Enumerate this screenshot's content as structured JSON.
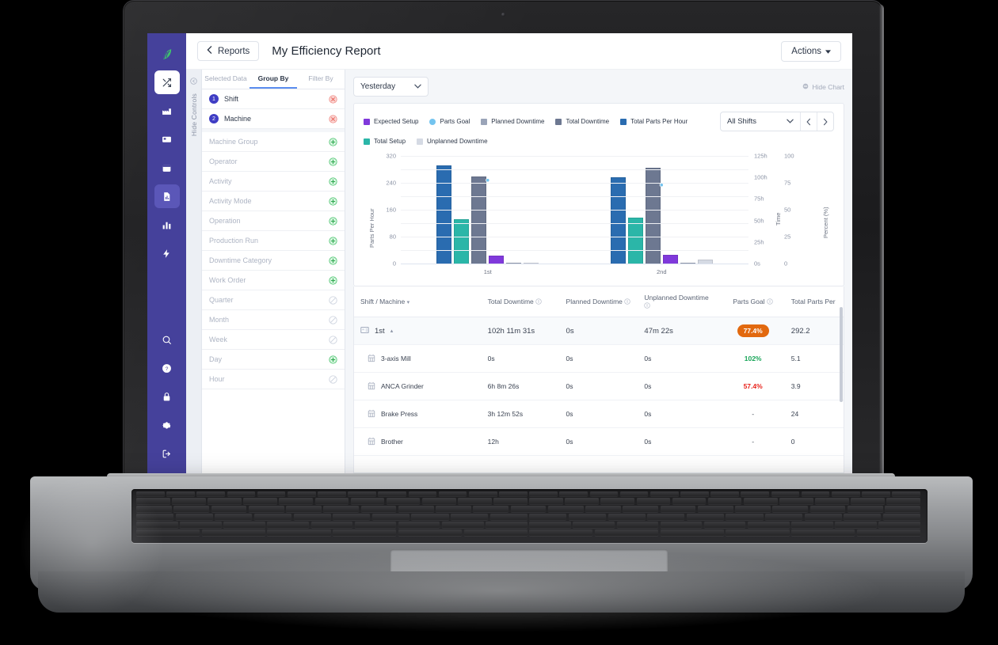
{
  "brand": {
    "logo_icon": "leaf-logo-icon",
    "nav_bg": "#45419b"
  },
  "left_nav": {
    "items": [
      {
        "icon": "shuffle-icon",
        "name": "shuffle",
        "state": "white"
      },
      {
        "icon": "factory-icon",
        "name": "factory",
        "state": "normal"
      },
      {
        "icon": "machine-monitor-icon",
        "name": "machine-monitor",
        "state": "normal"
      },
      {
        "icon": "calendar-icon",
        "name": "calendar",
        "state": "normal"
      },
      {
        "icon": "report-icon",
        "name": "report",
        "state": "active"
      },
      {
        "icon": "bar-chart-icon",
        "name": "analytics",
        "state": "normal"
      },
      {
        "icon": "bolt-icon",
        "name": "energy",
        "state": "normal"
      }
    ],
    "bottom_items": [
      {
        "icon": "search-icon",
        "name": "search"
      },
      {
        "icon": "help-icon",
        "name": "help"
      },
      {
        "icon": "lock-icon",
        "name": "lock"
      },
      {
        "icon": "gear-icon",
        "name": "settings"
      },
      {
        "icon": "logout-icon",
        "name": "logout"
      }
    ]
  },
  "topbar": {
    "back_label": "Reports",
    "back_icon": "chevron-left-icon",
    "title": "My Efficiency Report",
    "actions_label": "Actions",
    "actions_caret_icon": "caret-down-icon"
  },
  "controls": {
    "rail_label": "Hide Controls",
    "rail_icon": "collapse-icon",
    "tabs": [
      {
        "label": "Selected Data",
        "active": false
      },
      {
        "label": "Group By",
        "active": true
      },
      {
        "label": "Filter By",
        "active": false
      }
    ],
    "selected": [
      {
        "index": "1",
        "label": "Shift",
        "action_icon": "remove-icon"
      },
      {
        "index": "2",
        "label": "Machine",
        "action_icon": "remove-icon"
      }
    ],
    "available": [
      {
        "label": "Machine Group",
        "action_icon": "add-icon",
        "enabled": true
      },
      {
        "label": "Operator",
        "action_icon": "add-icon",
        "enabled": true
      },
      {
        "label": "Activity",
        "action_icon": "add-icon",
        "enabled": true
      },
      {
        "label": "Activity Mode",
        "action_icon": "add-icon",
        "enabled": true
      },
      {
        "label": "Operation",
        "action_icon": "add-icon",
        "enabled": true
      },
      {
        "label": "Production Run",
        "action_icon": "add-icon",
        "enabled": true
      },
      {
        "label": "Downtime Category",
        "action_icon": "add-icon",
        "enabled": true
      },
      {
        "label": "Work Order",
        "action_icon": "add-icon",
        "enabled": true
      },
      {
        "label": "Quarter",
        "action_icon": "disabled-icon",
        "enabled": false
      },
      {
        "label": "Month",
        "action_icon": "disabled-icon",
        "enabled": false
      },
      {
        "label": "Week",
        "action_icon": "disabled-icon",
        "enabled": false
      },
      {
        "label": "Day",
        "action_icon": "add-icon",
        "enabled": true
      },
      {
        "label": "Hour",
        "action_icon": "disabled-icon",
        "enabled": false
      }
    ]
  },
  "main": {
    "date_range": "Yesterday",
    "date_caret_icon": "chevron-down-icon",
    "hide_chart_label": "Hide Chart",
    "hide_chart_icon": "hide-icon",
    "shift_selector": {
      "value": "All Shifts",
      "caret_icon": "chevron-down-icon",
      "prev_icon": "chevron-left-icon",
      "next_icon": "chevron-right-icon"
    }
  },
  "chart_data": {
    "type": "bar",
    "title": "",
    "categories": [
      "1st",
      "2nd"
    ],
    "xlabel": "",
    "ylabel": "Parts Per Hour",
    "ylim": [
      0,
      320
    ],
    "yticks": [
      0,
      80,
      160,
      240,
      320
    ],
    "y2label": "Time",
    "y2ticks": [
      "0s",
      "25h",
      "50h",
      "75h",
      "100h",
      "125h"
    ],
    "y3label": "Percent (%)",
    "y3ticks": [
      0,
      25,
      50,
      75,
      100
    ],
    "grid": true,
    "legend_position": "top",
    "series": [
      {
        "name": "Total Parts Per Hour",
        "color": "#2a6cb0",
        "type": "bar",
        "values": [
          292.2,
          256.0
        ]
      },
      {
        "name": "Total Setup",
        "color": "#2bb6a8",
        "type": "bar",
        "values": [
          131.0,
          137.0
        ]
      },
      {
        "name": "Total Downtime",
        "color": "#6d7891",
        "type": "bar",
        "values": [
          259.0,
          285.0
        ]
      },
      {
        "name": "Expected Setup",
        "color": "#8039db",
        "type": "bar",
        "values": [
          23.0,
          25.0
        ]
      },
      {
        "name": "Planned Downtime",
        "color": "#9aa4b8",
        "type": "bar",
        "values": [
          0.0,
          0.0
        ]
      },
      {
        "name": "Unplanned Downtime",
        "color": "#d5dae4",
        "type": "bar",
        "values": [
          1.5,
          11.0
        ]
      },
      {
        "name": "Parts Goal",
        "color": "#74c4ef",
        "type": "line",
        "values": [
          77.4,
          73.0
        ]
      }
    ],
    "legend": [
      {
        "label": "Expected Setup",
        "color": "#8039db",
        "shape": "square"
      },
      {
        "label": "Parts Goal",
        "color": "#74c4ef",
        "shape": "circle"
      },
      {
        "label": "Planned Downtime",
        "color": "#9aa4b8",
        "shape": "square"
      },
      {
        "label": "Total Downtime",
        "color": "#6d7891",
        "shape": "square"
      },
      {
        "label": "Total Parts Per Hour",
        "color": "#2a6cb0",
        "shape": "square"
      },
      {
        "label": "Total Setup",
        "color": "#2bb6a8",
        "shape": "square"
      },
      {
        "label": "Unplanned Downtime",
        "color": "#d5dae4",
        "shape": "square"
      }
    ]
  },
  "table": {
    "columns": [
      {
        "label": "Shift / Machine",
        "icon": "chevron-down-icon"
      },
      {
        "label": "Total Downtime",
        "icon": "info-icon"
      },
      {
        "label": "Planned Downtime",
        "icon": "info-icon"
      },
      {
        "label": "Unplanned Downtime",
        "icon": "info-icon"
      },
      {
        "label": "Parts Goal",
        "icon": "info-icon"
      },
      {
        "label": "Total Parts Per",
        "icon": ""
      }
    ],
    "rows": [
      {
        "type": "group",
        "icon": "shift-icon",
        "name": "1st",
        "sort_icon": "caret-up-icon",
        "total_downtime": "102h 11m 31s",
        "planned_downtime": "0s",
        "unplanned_downtime": "47m 22s",
        "parts_goal": "77.4%",
        "parts_goal_style": "badge",
        "total_parts": "292.2"
      },
      {
        "type": "machine",
        "icon": "machine-icon",
        "name": "3-axis Mill",
        "total_downtime": "0s",
        "planned_downtime": "0s",
        "unplanned_downtime": "0s",
        "parts_goal": "102%",
        "parts_goal_style": "good",
        "total_parts": "5.1"
      },
      {
        "type": "machine",
        "icon": "machine-icon",
        "name": "ANCA Grinder",
        "total_downtime": "6h 8m 26s",
        "planned_downtime": "0s",
        "unplanned_downtime": "0s",
        "parts_goal": "57.4%",
        "parts_goal_style": "bad",
        "total_parts": "3.9"
      },
      {
        "type": "machine",
        "icon": "machine-icon",
        "name": "Brake Press",
        "total_downtime": "3h 12m 52s",
        "planned_downtime": "0s",
        "unplanned_downtime": "0s",
        "parts_goal": "-",
        "parts_goal_style": "plain",
        "total_parts": "24"
      },
      {
        "type": "machine",
        "icon": "machine-icon",
        "name": "Brother",
        "total_downtime": "12h",
        "planned_downtime": "0s",
        "unplanned_downtime": "0s",
        "parts_goal": "-",
        "parts_goal_style": "plain",
        "total_parts": "0"
      }
    ]
  }
}
